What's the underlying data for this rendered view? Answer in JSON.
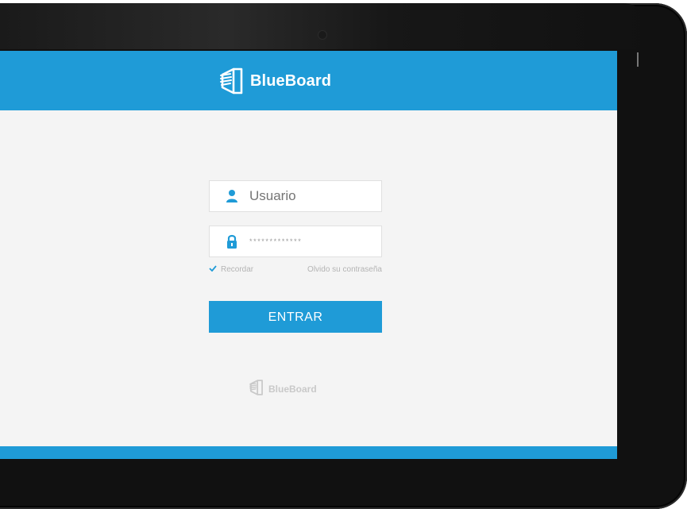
{
  "app": {
    "name": "BlueBoard"
  },
  "login": {
    "username_placeholder": "Usuario",
    "password_masked": "*************",
    "remember_label": "Recordar",
    "forgot_label": "Olvido su contraseña",
    "submit_label": "ENTRAR"
  },
  "footer": {
    "brand_name": "BlueBoard"
  },
  "icons": {
    "logo": "blueboard-logo-icon",
    "user": "user-icon",
    "lock": "lock-icon",
    "check": "check-icon",
    "camera": "camera-icon"
  },
  "colors": {
    "primary": "#1f9bd7",
    "background": "#f4f4f4",
    "muted_text": "#b4b4b4"
  }
}
